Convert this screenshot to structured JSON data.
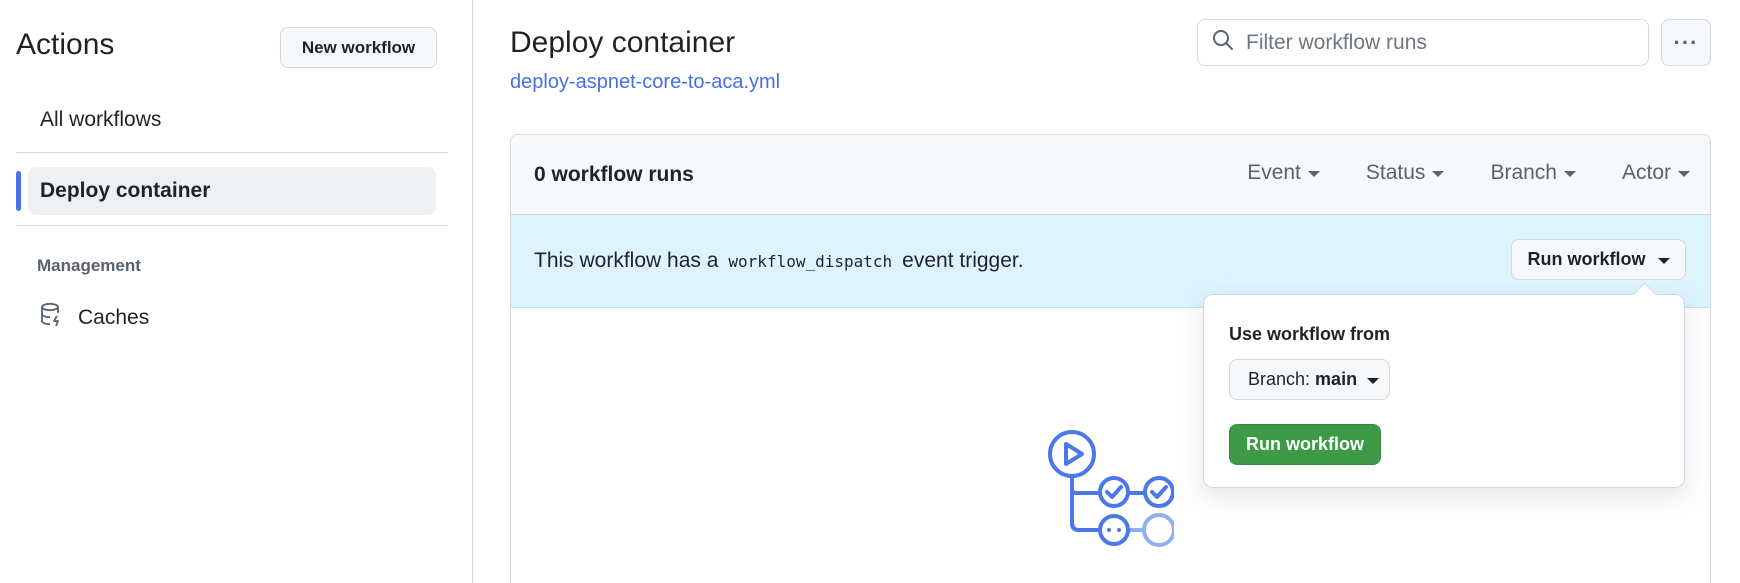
{
  "sidebar": {
    "title": "Actions",
    "new_workflow_label": "New workflow",
    "items": [
      {
        "label": "All workflows"
      },
      {
        "label": "Deploy container",
        "active": true
      }
    ],
    "section_heading": "Management",
    "caches_label": "Caches",
    "icons": {
      "caches": "database-cache-icon"
    }
  },
  "main": {
    "title": "Deploy container",
    "workflow_file": "deploy-aspnet-core-to-aca.yml",
    "search": {
      "placeholder": "Filter workflow runs",
      "icon": "search-icon"
    },
    "more_icon": "kebab-horizontal-icon",
    "runs_count": "0 workflow runs",
    "filters": [
      "Event",
      "Status",
      "Branch",
      "Actor"
    ],
    "banner": {
      "text_before": "This workflow has a",
      "code": "workflow_dispatch",
      "text_after": "event trigger.",
      "run_button_label": "Run workflow"
    },
    "popover": {
      "label": "Use workflow from",
      "branch_prefix": "Branch:",
      "branch_value": "main",
      "submit_label": "Run workflow"
    },
    "empty_state_icon": "workflow-graph-icon"
  },
  "colors": {
    "accent": "#4872f0",
    "link": "#4370e8",
    "primary_button": "#3f9a48",
    "banner_bg": "#ddf4ff"
  }
}
